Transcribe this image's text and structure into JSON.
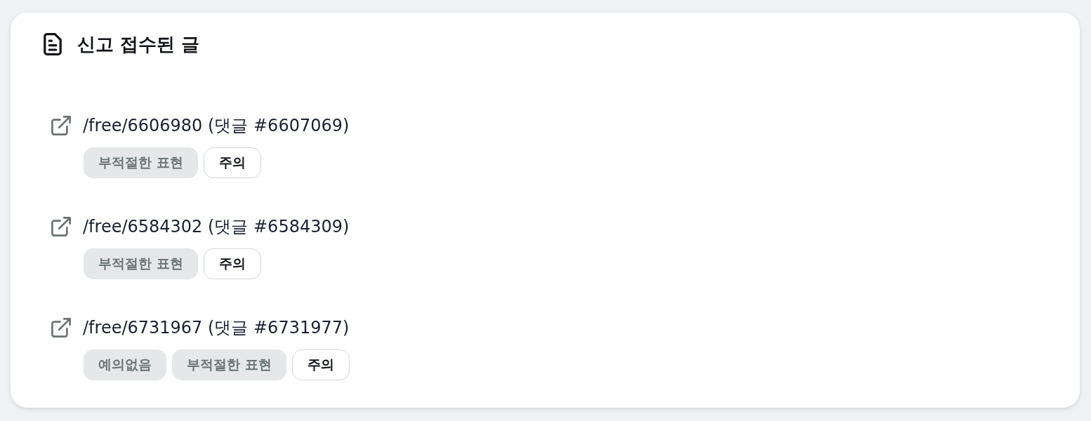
{
  "panel": {
    "title": "신고 접수된 글"
  },
  "reports": [
    {
      "link": "/free/6606980 (댓글 #6607069)",
      "tags": [
        {
          "kind": "category",
          "label": "부적절한 표현"
        },
        {
          "kind": "severity",
          "label": "주의"
        }
      ]
    },
    {
      "link": "/free/6584302 (댓글 #6584309)",
      "tags": [
        {
          "kind": "category",
          "label": "부적절한 표현"
        },
        {
          "kind": "severity",
          "label": "주의"
        }
      ]
    },
    {
      "link": "/free/6731967 (댓글 #6731977)",
      "tags": [
        {
          "kind": "category",
          "label": "예의없음"
        },
        {
          "kind": "category",
          "label": "부적절한 표현"
        },
        {
          "kind": "severity",
          "label": "주의"
        }
      ]
    }
  ]
}
